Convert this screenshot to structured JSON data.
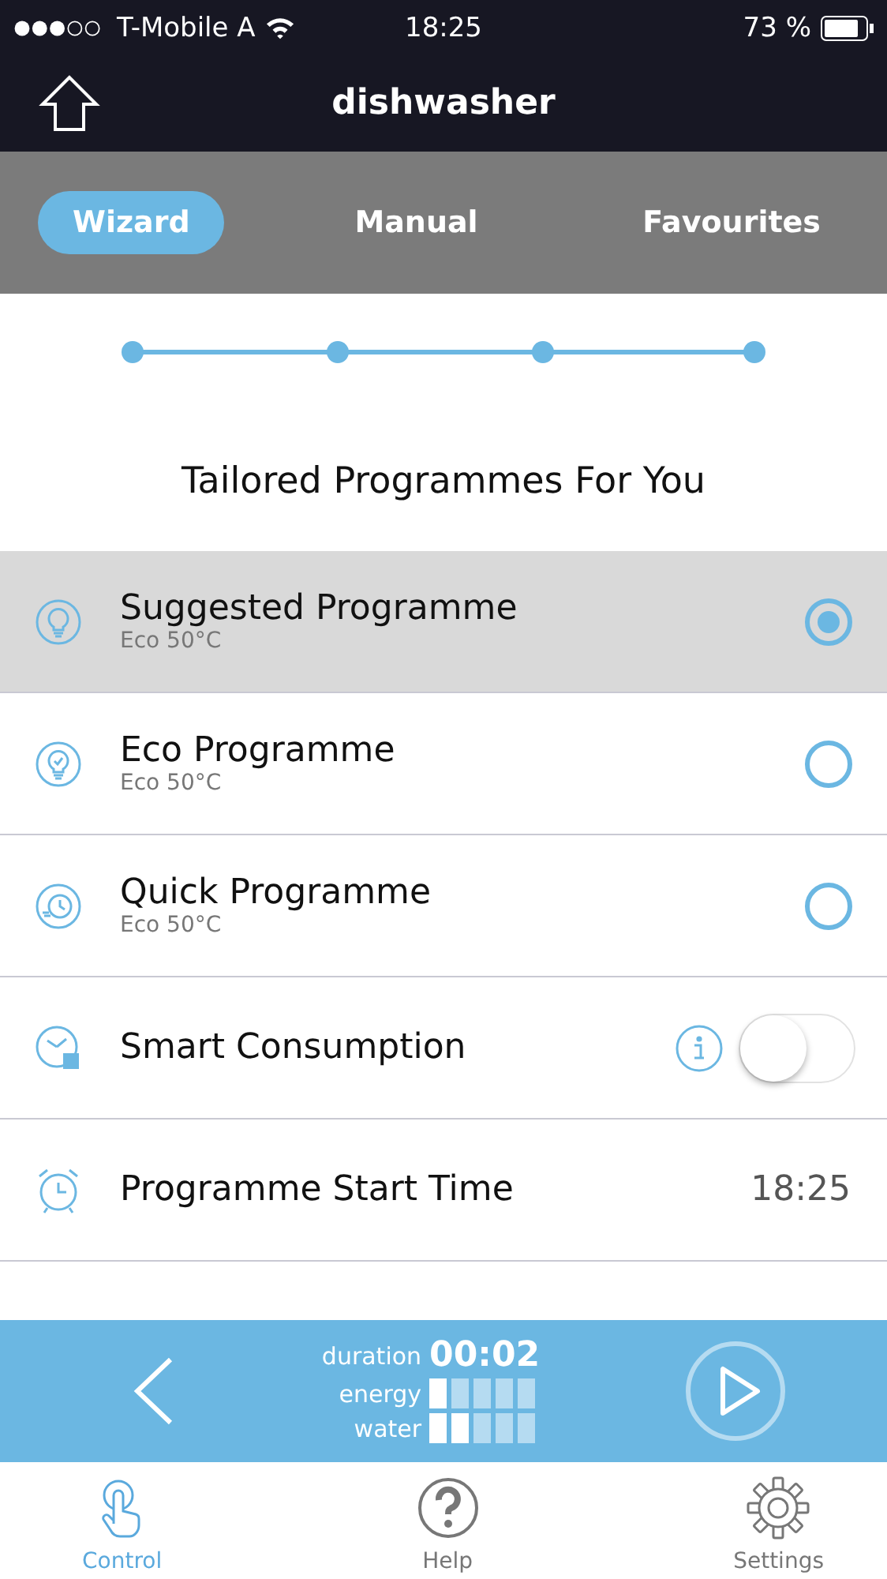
{
  "status_bar": {
    "carrier": "T-Mobile A",
    "time": "18:25",
    "battery": "73 %"
  },
  "nav": {
    "title": "dishwasher"
  },
  "tabs": [
    {
      "label": "Wizard",
      "selected": true
    },
    {
      "label": "Manual",
      "selected": false
    },
    {
      "label": "Favourites",
      "selected": false
    }
  ],
  "heading": "Tailored Programmes For You",
  "rows": [
    {
      "kind": "radio",
      "title": "Suggested Programme",
      "subtitle": "Eco 50°C",
      "selected": true
    },
    {
      "kind": "radio",
      "title": "Eco Programme",
      "subtitle": "Eco 50°C",
      "selected": false
    },
    {
      "kind": "radio",
      "title": "Quick Programme",
      "subtitle": "Eco 50°C",
      "selected": false
    },
    {
      "kind": "toggle",
      "title": "Smart Consumption",
      "on": false
    },
    {
      "kind": "time",
      "title": "Programme Start Time",
      "value": "18:25"
    }
  ],
  "summary": {
    "duration_label": "duration",
    "duration": "00:02",
    "meters": [
      {
        "label": "energy",
        "level": 0.2
      },
      {
        "label": "water",
        "level": 0.4
      }
    ]
  },
  "bottom_tabs": [
    {
      "label": "Control",
      "selected": true
    },
    {
      "label": "Help",
      "selected": false
    },
    {
      "label": "Settings",
      "selected": false
    }
  ]
}
